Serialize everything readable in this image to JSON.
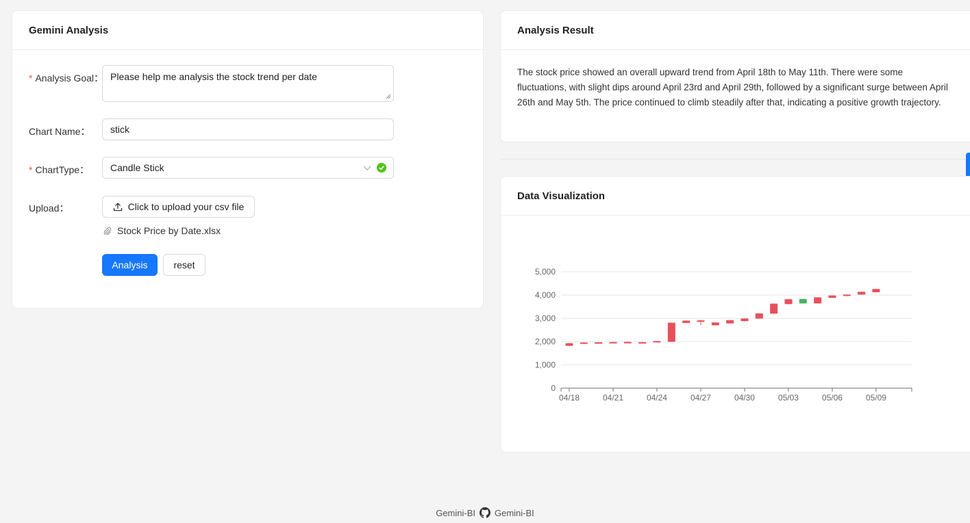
{
  "form": {
    "title": "Gemini Analysis",
    "goal_label": "Analysis Goal：",
    "goal_value": "Please help me analysis the stock trend per date",
    "chart_name_label": "Chart Name：",
    "chart_name_value": "stick",
    "chart_type_label": "ChartType：",
    "chart_type_value": "Candle Stick",
    "upload_label": "Upload：",
    "upload_button": "Click to upload your csv file",
    "uploaded_file": "Stock Price by Date.xlsx",
    "analysis_button": "Analysis",
    "reset_button": "reset"
  },
  "result": {
    "title": "Analysis Result",
    "text": "The stock price showed an overall upward trend from April 18th to May 11th. There were some fluctuations, with slight dips around April 23rd and April 29th, followed by a significant surge between April 26th and May 5th. The price continued to climb steadily after that, indicating a positive growth trajectory."
  },
  "viz": {
    "title": "Data Visualization"
  },
  "footer": {
    "left": "Gemini-BI",
    "right": "Gemini-BI"
  },
  "colors": {
    "up": "#e8505b",
    "down": "#47b262",
    "primary": "#1677ff"
  },
  "chart_data": {
    "type": "candlestick",
    "x_tick_labels": [
      "04/18",
      "04/21",
      "04/24",
      "04/27",
      "04/30",
      "05/03",
      "05/06",
      "05/09"
    ],
    "ylim": [
      0,
      5000
    ],
    "y_ticks": [
      "0",
      "1,000",
      "2,000",
      "3,000",
      "4,000",
      "5,000"
    ],
    "candles": [
      {
        "date": "04/18",
        "open": 1820,
        "close": 1930,
        "low": 1800,
        "high": 1950,
        "dir": "up"
      },
      {
        "date": "04/19",
        "open": 1930,
        "close": 1960,
        "low": 1920,
        "high": 1970,
        "dir": "up"
      },
      {
        "date": "04/20",
        "open": 1950,
        "close": 1970,
        "low": 1940,
        "high": 1980,
        "dir": "up"
      },
      {
        "date": "04/21",
        "open": 1960,
        "close": 1980,
        "low": 1950,
        "high": 1990,
        "dir": "up"
      },
      {
        "date": "04/22",
        "open": 1965,
        "close": 1985,
        "low": 1955,
        "high": 1995,
        "dir": "up"
      },
      {
        "date": "04/23",
        "open": 1955,
        "close": 1975,
        "low": 1945,
        "high": 1985,
        "dir": "up"
      },
      {
        "date": "04/24",
        "open": 1980,
        "close": 2020,
        "low": 1970,
        "high": 2030,
        "dir": "up"
      },
      {
        "date": "04/25",
        "open": 1990,
        "close": 2810,
        "low": 1980,
        "high": 2820,
        "dir": "up"
      },
      {
        "date": "04/26",
        "open": 2800,
        "close": 2900,
        "low": 2790,
        "high": 2910,
        "dir": "up"
      },
      {
        "date": "04/27",
        "open": 2890,
        "close": 2910,
        "low": 2700,
        "high": 2940,
        "dir": "up"
      },
      {
        "date": "04/28",
        "open": 2700,
        "close": 2820,
        "low": 2690,
        "high": 2830,
        "dir": "up"
      },
      {
        "date": "04/29",
        "open": 2780,
        "close": 2920,
        "low": 2770,
        "high": 2930,
        "dir": "up"
      },
      {
        "date": "04/30",
        "open": 2880,
        "close": 2990,
        "low": 2870,
        "high": 3000,
        "dir": "up"
      },
      {
        "date": "05/01",
        "open": 2990,
        "close": 3210,
        "low": 2980,
        "high": 3220,
        "dir": "up"
      },
      {
        "date": "05/02",
        "open": 3200,
        "close": 3630,
        "low": 3190,
        "high": 3640,
        "dir": "up"
      },
      {
        "date": "05/03",
        "open": 3610,
        "close": 3820,
        "low": 3600,
        "high": 3830,
        "dir": "up"
      },
      {
        "date": "05/04",
        "open": 3830,
        "close": 3640,
        "low": 3630,
        "high": 3840,
        "dir": "down"
      },
      {
        "date": "05/05",
        "open": 3640,
        "close": 3900,
        "low": 3630,
        "high": 3910,
        "dir": "up"
      },
      {
        "date": "05/06",
        "open": 3880,
        "close": 3980,
        "low": 3870,
        "high": 3990,
        "dir": "up"
      },
      {
        "date": "05/07",
        "open": 3960,
        "close": 4020,
        "low": 3950,
        "high": 4030,
        "dir": "up"
      },
      {
        "date": "05/08",
        "open": 4020,
        "close": 4140,
        "low": 4010,
        "high": 4150,
        "dir": "up"
      },
      {
        "date": "05/09",
        "open": 4120,
        "close": 4260,
        "low": 4110,
        "high": 4270,
        "dir": "up"
      }
    ]
  }
}
